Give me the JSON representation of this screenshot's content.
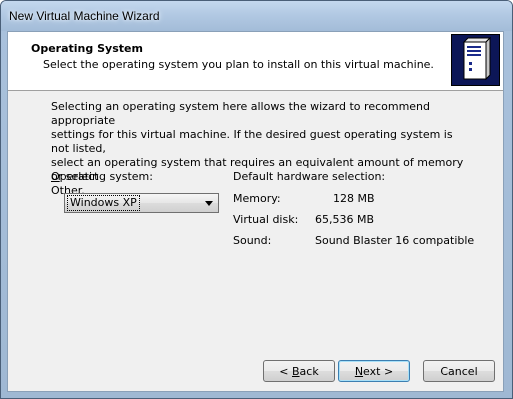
{
  "window": {
    "title": "New Virtual Machine Wizard"
  },
  "header": {
    "title": "Operating System",
    "subtitle": "Select the operating system you plan to install on this virtual machine.",
    "icon": "server-tower-icon"
  },
  "intro": {
    "line1": "Selecting an operating system here allows the wizard to recommend appropriate",
    "line2": "settings for this virtual machine. If the desired guest operating system is not listed,",
    "line3": "select an operating system that requires an equivalent amount of memory or select",
    "line4": "Other."
  },
  "os": {
    "label_prefix": "",
    "label_mnemonic": "O",
    "label_rest": "perating system:",
    "selected": "Windows XP"
  },
  "hardware": {
    "title": "Default hardware selection:",
    "memory_label": "Memory:",
    "memory_value": "128 MB",
    "disk_label": "Virtual disk:",
    "disk_value": "65,536 MB",
    "sound_label": "Sound:",
    "sound_value": "Sound Blaster 16 compatible"
  },
  "buttons": {
    "back_pre": "< ",
    "back_mnemonic": "B",
    "back_post": "ack",
    "next_mnemonic": "N",
    "next_post": "ext >",
    "cancel": "Cancel"
  },
  "colors": {
    "icon_background": "#0c1657",
    "titlebar": "#b2c9e3"
  }
}
